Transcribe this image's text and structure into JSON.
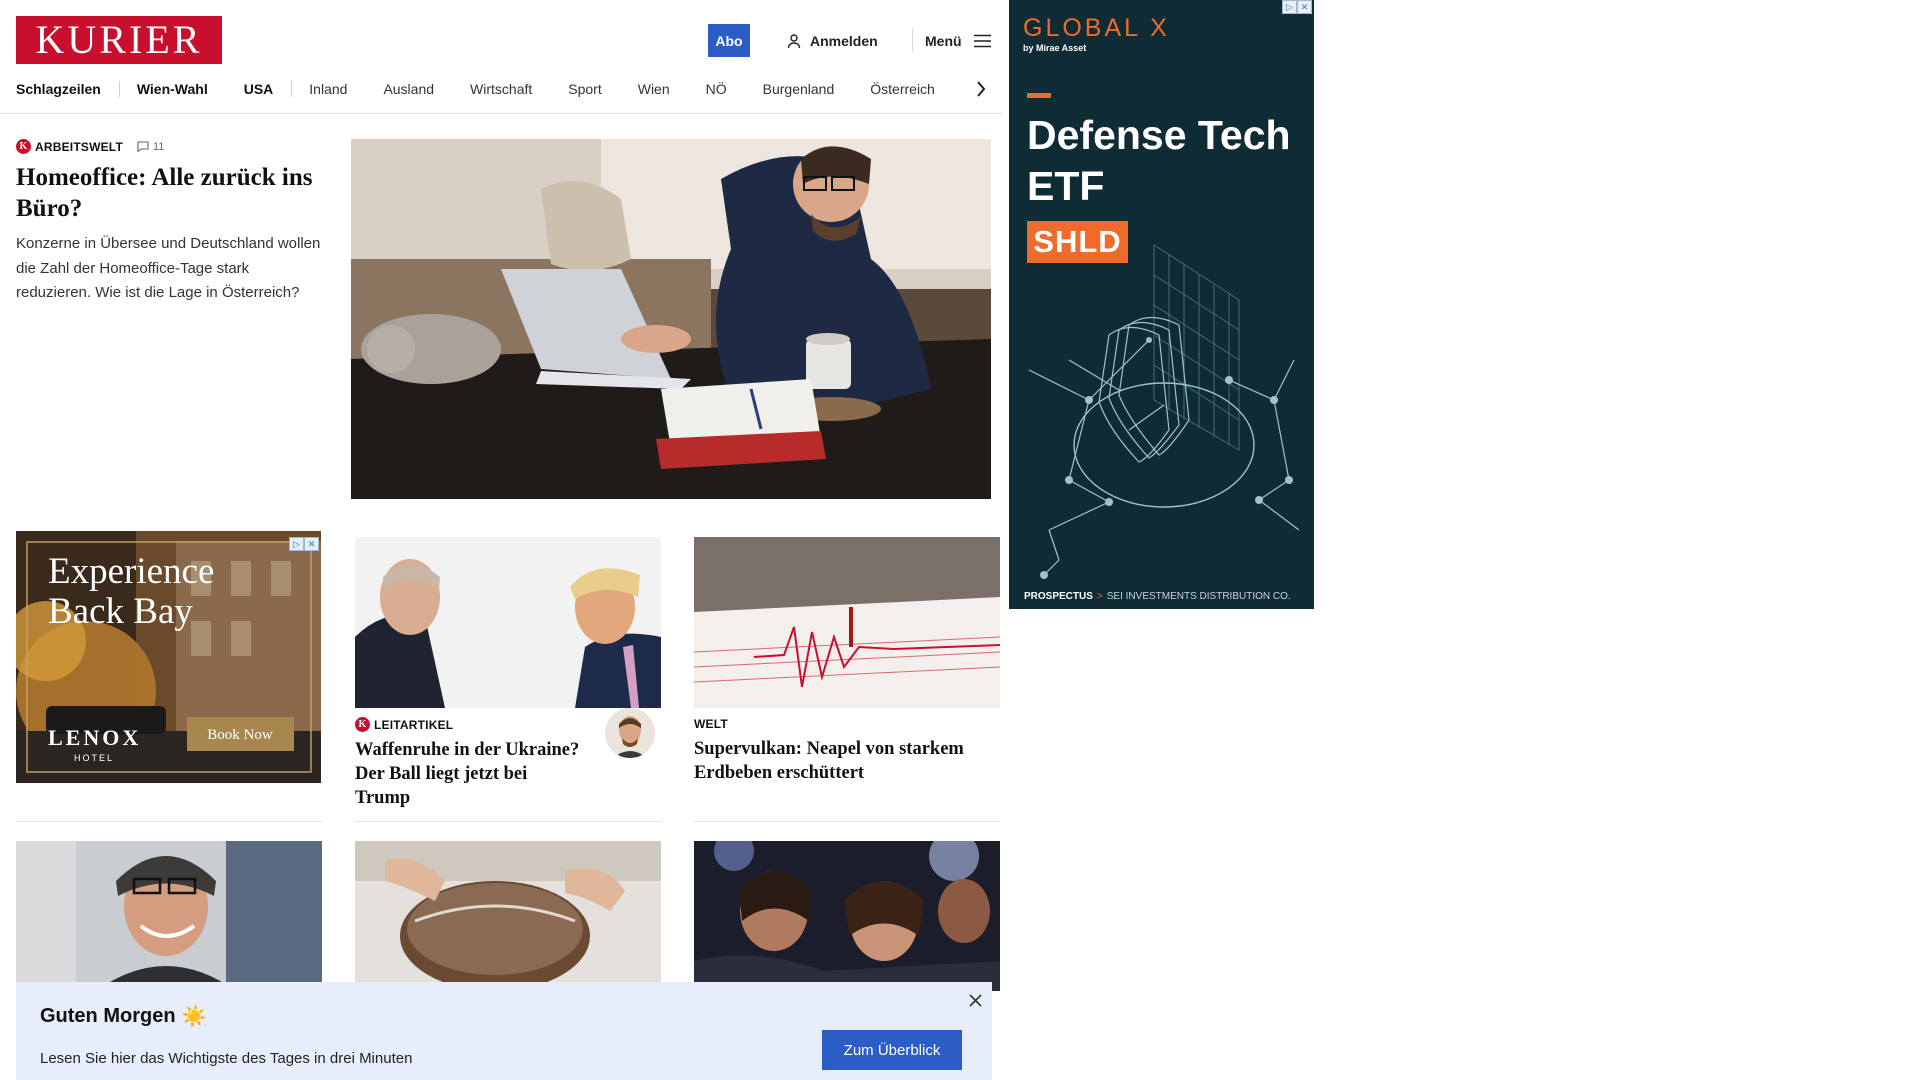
{
  "header": {
    "logo": "KURIER",
    "abo_label": "Abo",
    "login_label": "Anmelden",
    "menu_label": "Menü"
  },
  "nav": {
    "items": [
      "Schlagzeilen",
      "Wien-Wahl",
      "USA",
      "Inland",
      "Ausland",
      "Wirtschaft",
      "Sport",
      "Wien",
      "NÖ",
      "Burgenland",
      "Österreich"
    ]
  },
  "lead": {
    "badge": "K",
    "category": "ARBEITSWELT",
    "comments": "11",
    "title": "Homeoffice: Alle zurück ins Büro?",
    "description": "Konzerne in Übersee und Deutschland wollen die Zahl der Homeoffice-Tage stark reduzieren. Wie ist die Lage in Österreich?"
  },
  "ad_small": {
    "headline_line1": "Experience",
    "headline_line2": "Back Bay",
    "brand": "LENOX",
    "brand_sub": "HOTEL",
    "cta": "Book Now"
  },
  "cards": [
    {
      "badge": "K",
      "category": "LEITARTIKEL",
      "title": "Waffenruhe in der Ukraine? Der Ball liegt jetzt bei Trump"
    },
    {
      "category": "WELT",
      "title": "Supervulkan: Neapel von starkem Erdbeben erschüttert"
    }
  ],
  "banner": {
    "title": "Guten Morgen",
    "emoji": "☀️",
    "subtitle": "Lesen Sie hier das Wichtigste des Tages in drei Minuten",
    "button": "Zum Überblick"
  },
  "side_ad": {
    "brand": "GLOBAL X",
    "brand_sub": "by Mirae Asset",
    "headline": "Defense Tech ETF",
    "ticker": "SHLD",
    "footer_link": "PROSPECTUS",
    "footer_arrow": ">",
    "footer_text": "SEI INVESTMENTS DISTRIBUTION CO."
  },
  "colors": {
    "brand_red": "#c8102e",
    "accent_blue": "#2c5cc5",
    "banner_bg": "#e7eef9",
    "ad_dark": "#0f2b35",
    "ad_orange": "#ee6b2b"
  }
}
